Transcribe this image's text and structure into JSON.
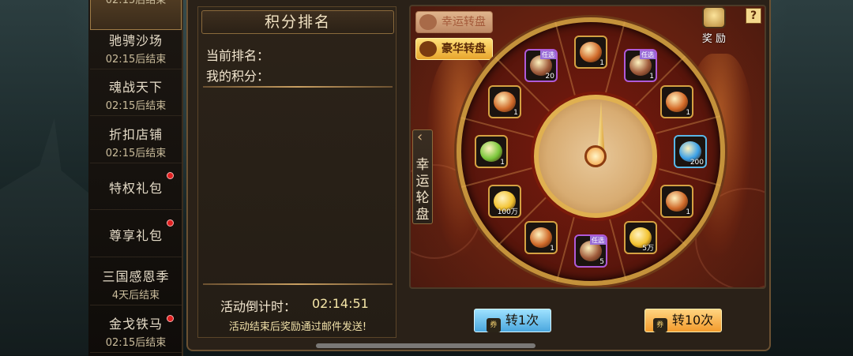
{
  "sidebar": {
    "items": [
      {
        "name": "",
        "sub": "02:15后结束"
      },
      {
        "name": "驰骋沙场",
        "sub": "02:15后结束"
      },
      {
        "name": "魂战天下",
        "sub": "02:15后结束"
      },
      {
        "name": "折扣店铺",
        "sub": "02:15后结束"
      },
      {
        "name": "特权礼包",
        "sub": ""
      },
      {
        "name": "尊享礼包",
        "sub": ""
      },
      {
        "name": "三国感恩季",
        "sub": "4天后结束"
      },
      {
        "name": "金戈铁马",
        "sub": "02:15后结束"
      }
    ]
  },
  "rank_panel": {
    "title": "积分排名",
    "current_rank_label": "当前排名：",
    "my_score_label": "我的积分：",
    "countdown_label": "活动倒计时：",
    "countdown_value": "02:14:51",
    "notice": "活动结束后奖励通过邮件发送!"
  },
  "wheel_panel": {
    "tab_lucky": "幸运转盘",
    "tab_luxury": "豪华转盘",
    "reward_label": "奖 励",
    "help": "?",
    "side_tab": "幸运轮盘",
    "items": [
      {
        "count": "1",
        "tag": "",
        "tag2": "任选",
        "art": "chest-purple",
        "color": "#a05c3c"
      },
      {
        "count": "1",
        "tag": "",
        "tag2": "",
        "art": "orange-coin",
        "color": "#d46a28"
      },
      {
        "count": "200",
        "tag": "",
        "tag2": "",
        "art": "blue-gem",
        "color": "#3aa0e8"
      },
      {
        "count": "1",
        "tag": "",
        "tag2": "",
        "art": "orange-scroll",
        "color": "#d06a2a"
      },
      {
        "count": "5万",
        "tag": "",
        "tag2": "",
        "art": "gold-coin",
        "color": "#f2c230"
      },
      {
        "count": "5",
        "tag": "",
        "tag2": "任选",
        "art": "chest-purple",
        "color": "#a05c3c"
      },
      {
        "count": "1",
        "tag": "",
        "tag2": "",
        "art": "orange-hand",
        "color": "#d06a2a"
      },
      {
        "count": "100万",
        "tag": "",
        "tag2": "",
        "art": "gold-coin",
        "color": "#f2c230"
      },
      {
        "count": "1",
        "tag": "",
        "tag2": "",
        "art": "green-gem-chest",
        "color": "#7ac63a"
      },
      {
        "count": "1",
        "tag": "",
        "tag2": "",
        "art": "orange-scroll",
        "color": "#d06a2a"
      },
      {
        "count": "20",
        "tag": "",
        "tag2": "任选",
        "art": "chest-purple",
        "color": "#a05c3c"
      },
      {
        "count": "1",
        "tag": "",
        "tag2": "",
        "art": "orange-item",
        "color": "#d06a2a"
      }
    ]
  },
  "buttons": {
    "spin_once": "转1次",
    "spin_ten": "转10次"
  }
}
